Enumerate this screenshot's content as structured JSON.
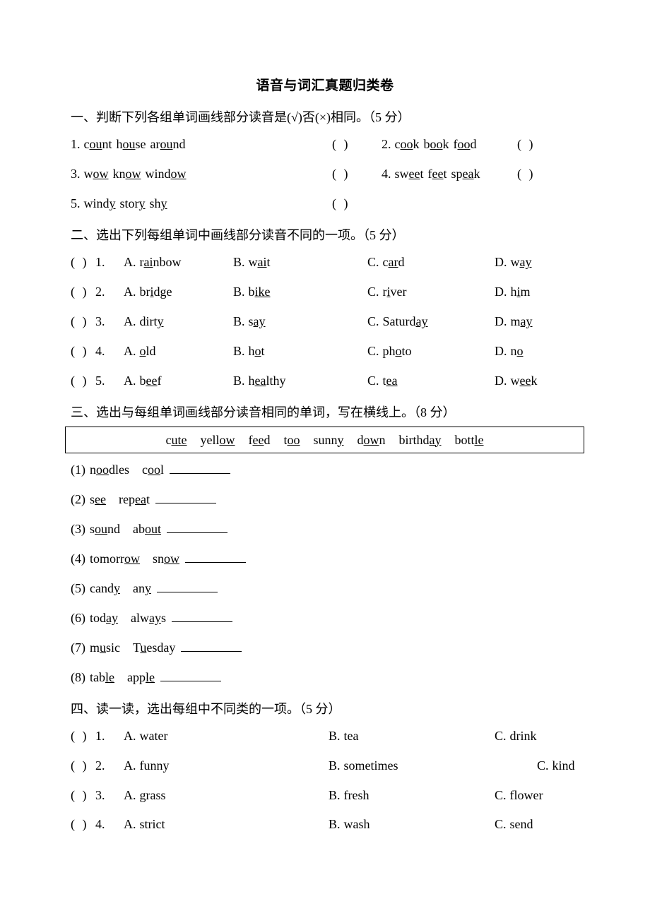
{
  "document": {
    "title": "语音与词汇真题归类卷"
  },
  "sections": [
    {
      "id": "section-1",
      "heading": "一、判断下列各组单词画线部分读音是(√)否(×)相同。（5 分）",
      "type": "judge",
      "items": [
        {
          "number": "1.",
          "words": [
            {
              "pre": "c",
              "mark": "ou",
              "post": "nt"
            },
            {
              "pre": "h",
              "mark": "ou",
              "post": "se"
            },
            {
              "pre": "ar",
              "mark": "ou",
              "post": "nd"
            }
          ],
          "answer_box": "(   )"
        },
        {
          "number": "2.",
          "words": [
            {
              "pre": "c",
              "mark": "oo",
              "post": "k"
            },
            {
              "pre": "b",
              "mark": "oo",
              "post": "k"
            },
            {
              "pre": "f",
              "mark": "oo",
              "post": "d"
            }
          ],
          "answer_box": "(   )"
        },
        {
          "number": "3.",
          "words": [
            {
              "pre": "w",
              "mark": "ow",
              "post": ""
            },
            {
              "pre": "kn",
              "mark": "ow",
              "post": ""
            },
            {
              "pre": "wind",
              "mark": "ow",
              "post": ""
            }
          ],
          "answer_box": "(   )"
        },
        {
          "number": "4.",
          "words": [
            {
              "pre": "sw",
              "mark": "ee",
              "post": "t"
            },
            {
              "pre": "f",
              "mark": "ee",
              "post": "t"
            },
            {
              "pre": "sp",
              "mark": "ea",
              "post": "k"
            }
          ],
          "answer_box": "(   )"
        },
        {
          "number": "5.",
          "words": [
            {
              "pre": "wind",
              "mark": "y",
              "post": ""
            },
            {
              "pre": "stor",
              "mark": "y",
              "post": ""
            },
            {
              "pre": "sh",
              "mark": "y",
              "post": ""
            }
          ],
          "answer_box": "(   )"
        }
      ]
    },
    {
      "id": "section-2",
      "heading": "二、选出下列每组单词中画线部分读音不同的一项。（5 分）",
      "type": "choice-underline",
      "items": [
        {
          "answer_box": "(   )",
          "number": "1.",
          "options": [
            {
              "letter": "A.",
              "pre": "r",
              "mark": "ai",
              "post": "nbow"
            },
            {
              "letter": "B.",
              "pre": "w",
              "mark": "ai",
              "post": "t"
            },
            {
              "letter": "C.",
              "pre": "c",
              "mark": "ar",
              "post": "d"
            },
            {
              "letter": "D.",
              "pre": "w",
              "mark": "ay",
              "post": ""
            }
          ]
        },
        {
          "answer_box": "(   )",
          "number": "2.",
          "options": [
            {
              "letter": "A.",
              "pre": "br",
              "mark": "i",
              "post": "dge"
            },
            {
              "letter": "B.",
              "pre": "b",
              "mark": "ike",
              "post": ""
            },
            {
              "letter": "C.",
              "pre": "r",
              "mark": "i",
              "post": "ver"
            },
            {
              "letter": "D.",
              "pre": "h",
              "mark": "i",
              "post": "m"
            }
          ]
        },
        {
          "answer_box": "(   )",
          "number": "3.",
          "options": [
            {
              "letter": "A.",
              "pre": "dirt",
              "mark": "y",
              "post": ""
            },
            {
              "letter": "B.",
              "pre": "s",
              "mark": "ay",
              "post": ""
            },
            {
              "letter": "C.",
              "pre": "Saturd",
              "mark": "ay",
              "post": ""
            },
            {
              "letter": "D.",
              "pre": "m",
              "mark": "ay",
              "post": ""
            }
          ]
        },
        {
          "answer_box": "(   )",
          "number": "4.",
          "options": [
            {
              "letter": "A.",
              "pre": "",
              "mark": "o",
              "post": "ld"
            },
            {
              "letter": "B.",
              "pre": "h",
              "mark": "o",
              "post": "t"
            },
            {
              "letter": "C.",
              "pre": "ph",
              "mark": "o",
              "post": "to"
            },
            {
              "letter": "D.",
              "pre": "n",
              "mark": "o",
              "post": ""
            }
          ]
        },
        {
          "answer_box": "(   )",
          "number": "5.",
          "options": [
            {
              "letter": "A.",
              "pre": "b",
              "mark": "ee",
              "post": "f"
            },
            {
              "letter": "B.",
              "pre": "h",
              "mark": "ea",
              "post": "lthy"
            },
            {
              "letter": "C.",
              "pre": "t",
              "mark": "ea",
              "post": ""
            },
            {
              "letter": "D.",
              "pre": "w",
              "mark": "ee",
              "post": "k"
            }
          ]
        }
      ]
    },
    {
      "id": "section-3",
      "heading": "三、选出与每组单词画线部分读音相同的单词，写在横线上。（8 分）",
      "type": "wordbank-fill",
      "word_bank": [
        {
          "pre": "c",
          "mark": "ute",
          "post": ""
        },
        {
          "pre": "yell",
          "mark": "ow",
          "post": ""
        },
        {
          "pre": "f",
          "mark": "ee",
          "post": "d"
        },
        {
          "pre": "t",
          "mark": "oo",
          "post": ""
        },
        {
          "pre": "sunn",
          "mark": "y",
          "post": ""
        },
        {
          "pre": "d",
          "mark": "ow",
          "post": "n"
        },
        {
          "pre": "birthd",
          "mark": "ay",
          "post": ""
        },
        {
          "pre": "bott",
          "mark": "le",
          "post": ""
        }
      ],
      "items": [
        {
          "number": "(1)",
          "words": [
            {
              "pre": "n",
              "mark": "oo",
              "post": "dles"
            },
            {
              "pre": "c",
              "mark": "oo",
              "post": "l"
            }
          ],
          "blank_width": 86
        },
        {
          "number": "(2)",
          "words": [
            {
              "pre": "s",
              "mark": "ee",
              "post": ""
            },
            {
              "pre": "rep",
              "mark": "ea",
              "post": "t"
            }
          ],
          "blank_width": 86
        },
        {
          "number": "(3)",
          "words": [
            {
              "pre": "s",
              "mark": "ou",
              "post": "nd"
            },
            {
              "pre": "ab",
              "mark": "out",
              "post": ""
            }
          ],
          "blank_width": 86
        },
        {
          "number": "(4)",
          "words": [
            {
              "pre": "tomorr",
              "mark": "ow",
              "post": ""
            },
            {
              "pre": "sn",
              "mark": "ow",
              "post": ""
            }
          ],
          "blank_width": 86
        },
        {
          "number": "(5)",
          "words": [
            {
              "pre": "cand",
              "mark": "y",
              "post": ""
            },
            {
              "pre": "an",
              "mark": "y",
              "post": ""
            }
          ],
          "blank_width": 86
        },
        {
          "number": "(6)",
          "words": [
            {
              "pre": "tod",
              "mark": "ay",
              "post": ""
            },
            {
              "pre": "alw",
              "mark": "ay",
              "post": "s"
            }
          ],
          "blank_width": 86
        },
        {
          "number": "(7)",
          "words": [
            {
              "pre": "m",
              "mark": "u",
              "post": "sic"
            },
            {
              "pre": "T",
              "mark": "u",
              "post": "esday"
            }
          ],
          "blank_width": 86
        },
        {
          "number": "(8)",
          "words": [
            {
              "pre": "tab",
              "mark": "le",
              "post": ""
            },
            {
              "pre": "app",
              "mark": "le",
              "post": ""
            }
          ],
          "blank_width": 86
        }
      ]
    },
    {
      "id": "section-4",
      "heading": "四、读一读，选出每组中不同类的一项。（5 分）",
      "type": "choice-plain",
      "items": [
        {
          "answer_box": "(   )",
          "number": "1.",
          "options": [
            {
              "letter": "A.",
              "word": "water"
            },
            {
              "letter": "B.",
              "word": "tea"
            },
            {
              "letter": "C.",
              "word": "drink"
            }
          ]
        },
        {
          "answer_box": "(   )",
          "number": "2.",
          "options": [
            {
              "letter": "A.",
              "word": "funny"
            },
            {
              "letter": "B.",
              "word": "sometimes"
            },
            {
              "letter": "C.",
              "word": "kind"
            }
          ]
        },
        {
          "answer_box": "(   )",
          "number": "3.",
          "options": [
            {
              "letter": "A.",
              "word": "grass"
            },
            {
              "letter": "B.",
              "word": "fresh"
            },
            {
              "letter": "C.",
              "word": "flower"
            }
          ]
        },
        {
          "answer_box": "(   )",
          "number": "4.",
          "options": [
            {
              "letter": "A.",
              "word": "strict"
            },
            {
              "letter": "B.",
              "word": "wash"
            },
            {
              "letter": "C.",
              "word": "send"
            }
          ]
        }
      ]
    }
  ]
}
